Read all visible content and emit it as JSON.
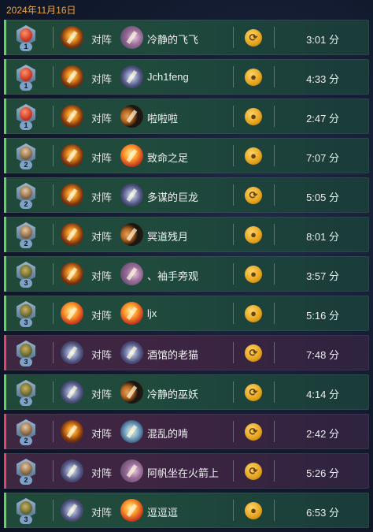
{
  "date": "2024年11月16日",
  "vs_label": "对阵",
  "colors": {
    "win": "#5fd65a",
    "loss": "#e0446a",
    "date": "#e9a74a"
  },
  "matches": [
    {
      "result": "win",
      "rank_level": "1",
      "rank_style": "red",
      "my_hero": "fire",
      "opp_icon": "claw",
      "opponent": "冷静的飞飞",
      "medal": "swirl",
      "time": "3:01 分"
    },
    {
      "result": "win",
      "rank_level": "1",
      "rank_style": "red",
      "my_hero": "fire",
      "opp_icon": "blade",
      "opponent": "Jch1feng",
      "medal": "plain",
      "time": "4:33 分"
    },
    {
      "result": "win",
      "rank_level": "1",
      "rank_style": "red",
      "my_hero": "fire",
      "opp_icon": "crescent",
      "opponent": "啦啦啦",
      "medal": "plain",
      "time": "2:47 分"
    },
    {
      "result": "win",
      "rank_level": "2",
      "rank_style": "portrait",
      "my_hero": "fire",
      "opp_icon": "orange",
      "opponent": "致命之足",
      "medal": "plain",
      "time": "7:07 分"
    },
    {
      "result": "win",
      "rank_level": "2",
      "rank_style": "portrait",
      "my_hero": "fire",
      "opp_icon": "blade",
      "opponent": "多谋的巨龙",
      "medal": "swirl",
      "time": "5:05 分"
    },
    {
      "result": "win",
      "rank_level": "2",
      "rank_style": "portrait",
      "my_hero": "fire",
      "opp_icon": "crescent",
      "opponent": "冥道残月",
      "medal": "plain",
      "time": "8:01 分"
    },
    {
      "result": "win",
      "rank_level": "3",
      "rank_style": "goblin",
      "my_hero": "fire",
      "opp_icon": "claw",
      "opponent": "、袖手旁观",
      "medal": "plain",
      "time": "3:57 分"
    },
    {
      "result": "win",
      "rank_level": "3",
      "rank_style": "goblin",
      "my_hero": "orange",
      "opp_icon": "orange",
      "opponent": "ljx",
      "medal": "plain",
      "time": "5:16 分"
    },
    {
      "result": "loss",
      "rank_level": "3",
      "rank_style": "goblin",
      "my_hero": "blade",
      "opp_icon": "blade",
      "opponent": "酒馆的老猫",
      "medal": "swirl",
      "time": "7:48 分"
    },
    {
      "result": "win",
      "rank_level": "3",
      "rank_style": "goblin",
      "my_hero": "blade",
      "opp_icon": "crescent",
      "opponent": "冷静的巫妖",
      "medal": "swirl",
      "time": "4:14 分"
    },
    {
      "result": "loss",
      "rank_level": "2",
      "rank_style": "portrait",
      "my_hero": "fire",
      "opp_icon": "blue",
      "opponent": "混乱的啃",
      "medal": "swirl",
      "time": "2:42 分"
    },
    {
      "result": "loss",
      "rank_level": "2",
      "rank_style": "portrait",
      "my_hero": "blade",
      "opp_icon": "claw",
      "opponent": "阿帆坐在火箭上",
      "medal": "swirl",
      "time": "5:26 分"
    },
    {
      "result": "win",
      "rank_level": "3",
      "rank_style": "goblin",
      "my_hero": "blade",
      "opp_icon": "orange",
      "opponent": "逗逗逗",
      "medal": "plain",
      "time": "6:53 分"
    }
  ]
}
